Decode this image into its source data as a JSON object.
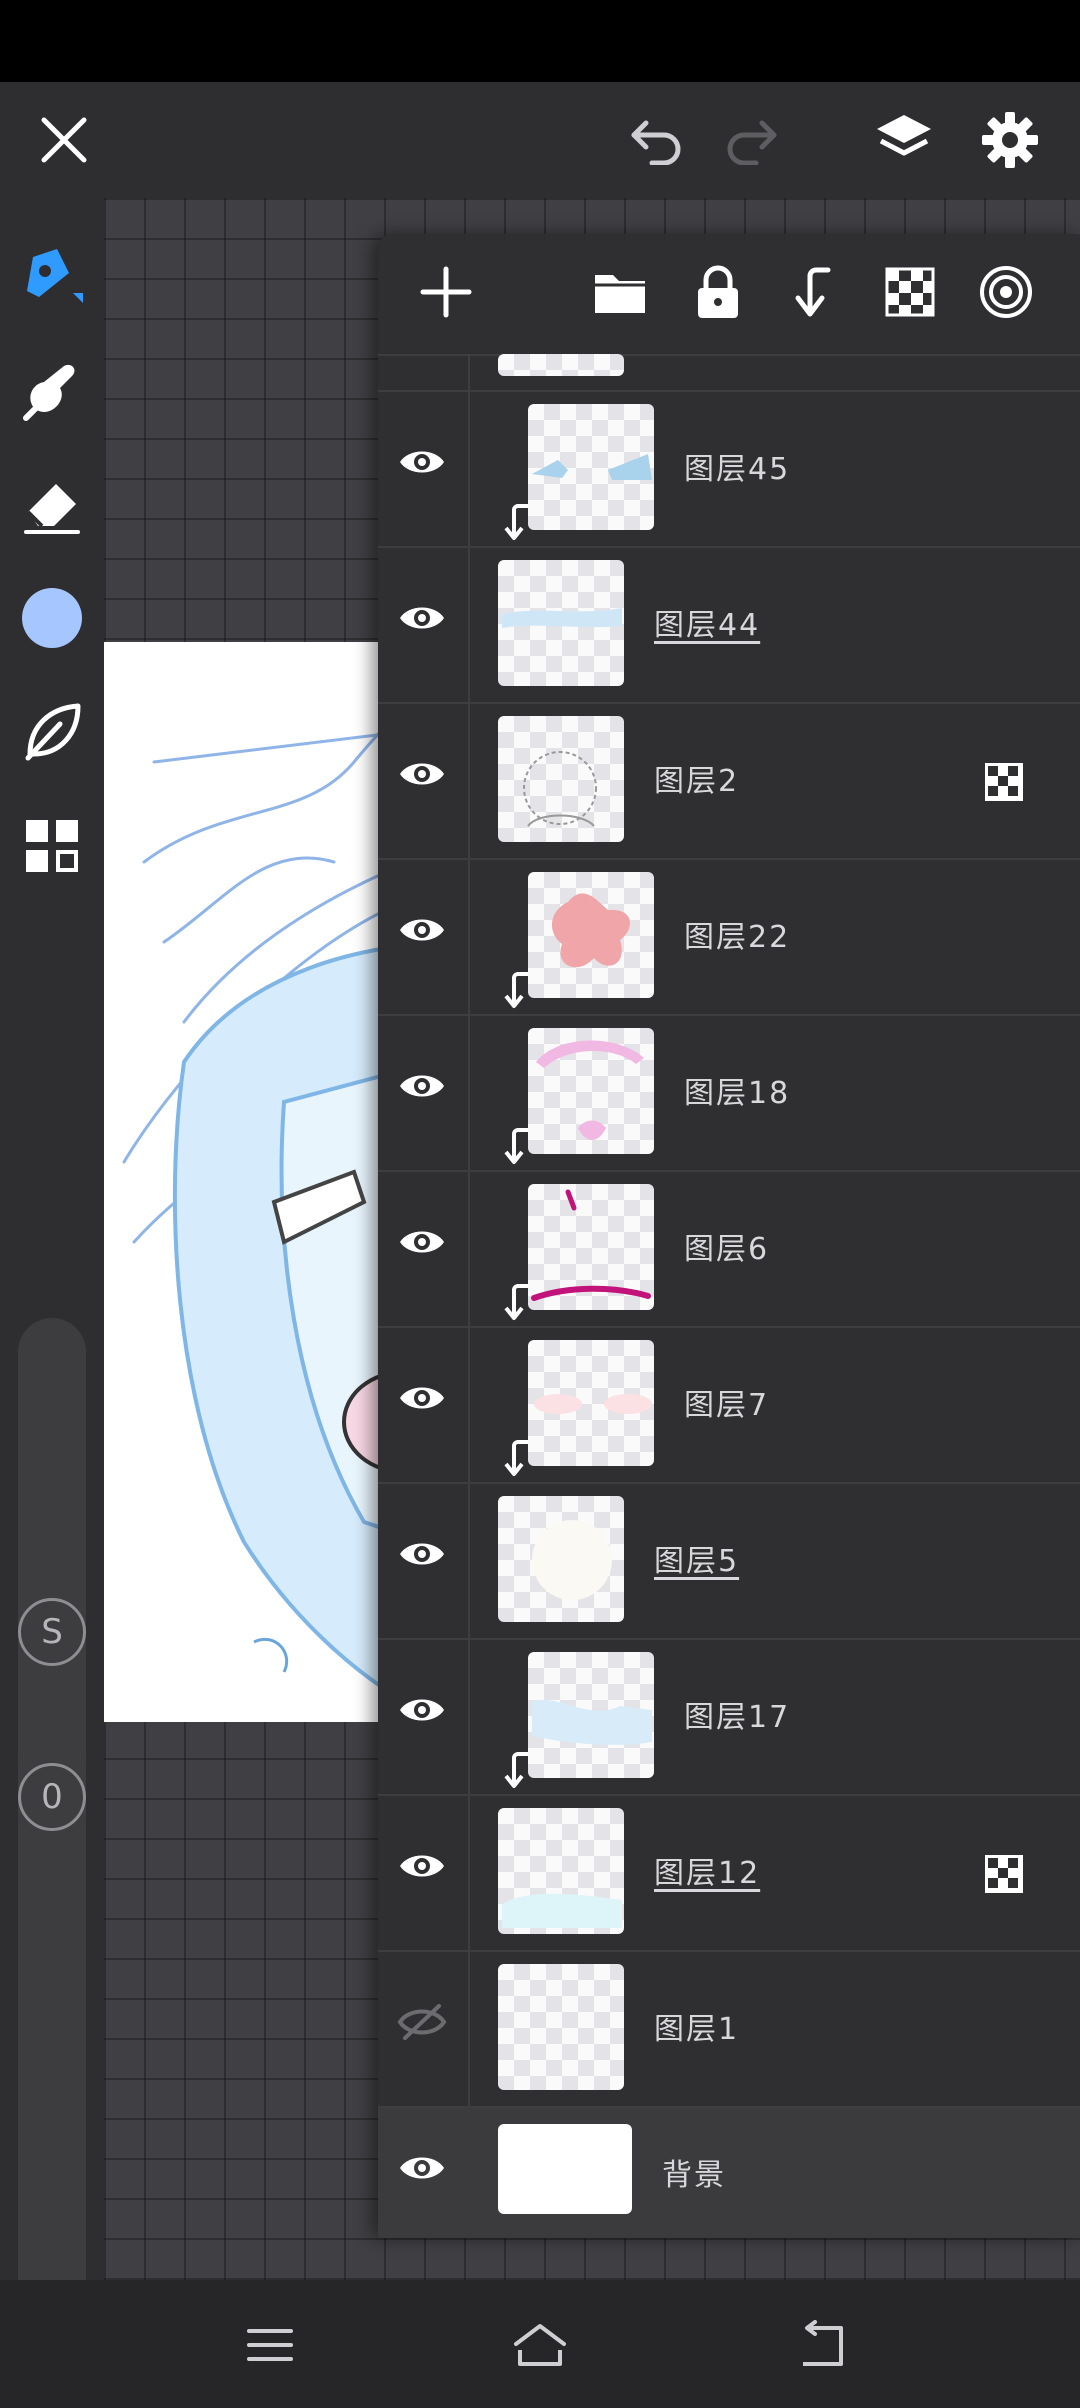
{
  "top_bar": {
    "close_icon": "close-icon",
    "undo_icon": "undo-icon",
    "redo_icon": "redo-icon",
    "layers_icon": "layers-icon",
    "settings_icon": "gear-icon"
  },
  "tools": [
    {
      "name": "pen-tool",
      "icon": "pen-icon",
      "active": true
    },
    {
      "name": "smudge-tool",
      "icon": "smudge-icon"
    },
    {
      "name": "eraser-tool",
      "icon": "eraser-icon"
    },
    {
      "name": "color-picker",
      "icon": "color-swatch",
      "color": "#a6c6ff"
    },
    {
      "name": "material-tool",
      "icon": "leaf-icon"
    },
    {
      "name": "menu-tool",
      "icon": "grid-icon"
    }
  ],
  "brush_size_label": "S",
  "brush_opacity_label": "0",
  "panel_toolbar": [
    "add-layer-icon",
    "folder-icon",
    "lock-icon",
    "clip-down-icon",
    "alpha-lock-icon",
    "opacity-icon"
  ],
  "layers": [
    {
      "name": "图层45",
      "clipped": true,
      "visible": true
    },
    {
      "name": "图层44",
      "clipped": false,
      "visible": true,
      "underline": true
    },
    {
      "name": "图层2",
      "clipped": false,
      "visible": true,
      "alpha_lock": true
    },
    {
      "name": "图层22",
      "clipped": true,
      "visible": true
    },
    {
      "name": "图层18",
      "clipped": true,
      "visible": true
    },
    {
      "name": "图层6",
      "clipped": true,
      "visible": true
    },
    {
      "name": "图层7",
      "clipped": true,
      "visible": true
    },
    {
      "name": "图层5",
      "clipped": false,
      "visible": true,
      "underline": true
    },
    {
      "name": "图层17",
      "clipped": true,
      "visible": true
    },
    {
      "name": "图层12",
      "clipped": false,
      "visible": true,
      "underline": true,
      "alpha_lock": true
    },
    {
      "name": "图层1",
      "clipped": false,
      "visible": false
    },
    {
      "name": "背景",
      "clipped": false,
      "visible": true,
      "selected": true
    }
  ],
  "nav": [
    "menu-icon",
    "home-icon",
    "back-icon"
  ],
  "colors": {
    "accent": "#2f9bff",
    "swatch": "#a6c6ff"
  }
}
